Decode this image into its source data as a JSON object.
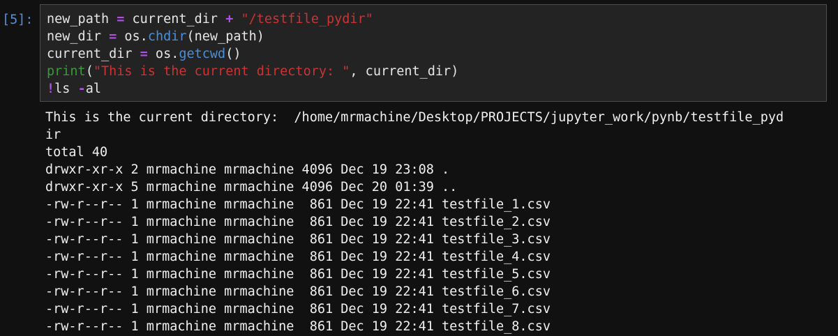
{
  "cell": {
    "prompt": "[5]:",
    "code": {
      "line1": {
        "var": "new_path ",
        "op1": "=",
        "mid": " current_dir ",
        "op2": "+",
        "sp": " ",
        "str": "\"/testfile_pydir\""
      },
      "line2": {
        "a": "new_dir ",
        "op": "=",
        "b": " os.",
        "fn": "chdir",
        "c": "(new_path)"
      },
      "line3": {
        "a": "current_dir ",
        "op": "=",
        "b": " os.",
        "fn": "getcwd",
        "c": "()"
      },
      "line4": {
        "builtin": "print",
        "a": "(",
        "str": "\"This is the current directory: \"",
        "b": ", current_dir)"
      },
      "line5": {
        "bang": "!",
        "a": "ls ",
        "op": "-",
        "b": "al"
      }
    },
    "output_lines": [
      "This is the current directory:  /home/mrmachine/Desktop/PROJECTS/jupyter_work/pynb/testfile_pyd",
      "ir",
      "total 40",
      "drwxr-xr-x 2 mrmachine mrmachine 4096 Dec 19 23:08 .",
      "drwxr-xr-x 5 mrmachine mrmachine 4096 Dec 20 01:39 ..",
      "-rw-r--r-- 1 mrmachine mrmachine  861 Dec 19 22:41 testfile_1.csv",
      "-rw-r--r-- 1 mrmachine mrmachine  861 Dec 19 22:41 testfile_2.csv",
      "-rw-r--r-- 1 mrmachine mrmachine  861 Dec 19 22:41 testfile_3.csv",
      "-rw-r--r-- 1 mrmachine mrmachine  861 Dec 19 22:41 testfile_4.csv",
      "-rw-r--r-- 1 mrmachine mrmachine  861 Dec 19 22:41 testfile_5.csv",
      "-rw-r--r-- 1 mrmachine mrmachine  861 Dec 19 22:41 testfile_6.csv",
      "-rw-r--r-- 1 mrmachine mrmachine  861 Dec 19 22:41 testfile_7.csv",
      "-rw-r--r-- 1 mrmachine mrmachine  861 Dec 19 22:41 testfile_8.csv"
    ]
  },
  "colors": {
    "background": "#111111",
    "input_background": "#232323",
    "prompt": "#5a8fd6",
    "operator": "#b24fe6",
    "string": "#cc3333",
    "function": "#4a8fd9",
    "builtin": "#3a9a3a"
  }
}
